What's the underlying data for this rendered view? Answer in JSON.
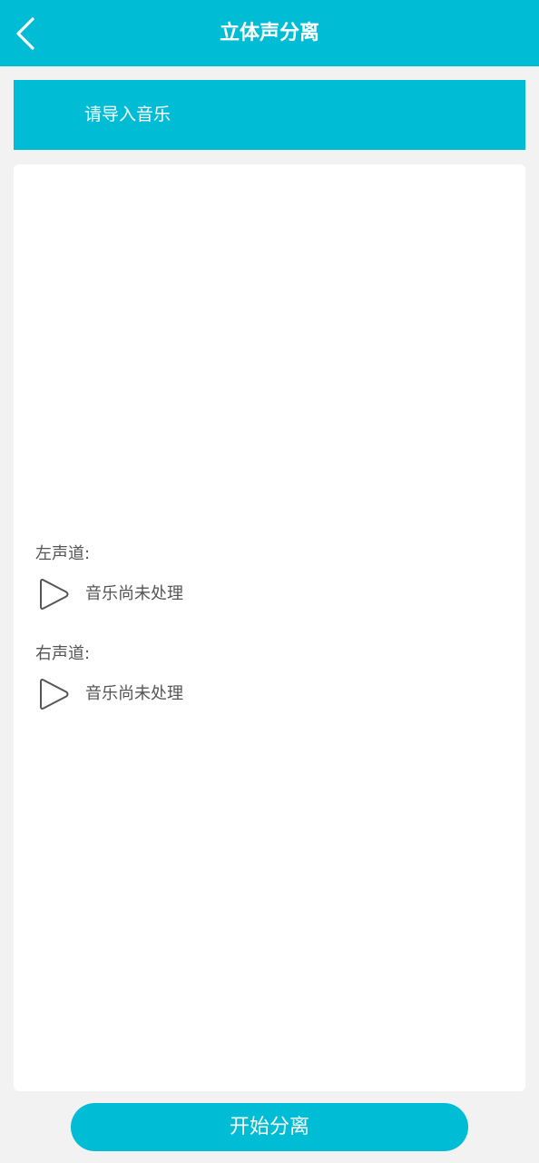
{
  "header": {
    "title": "立体声分离"
  },
  "import": {
    "label": "请导入音乐"
  },
  "channels": [
    {
      "label": "左声道:",
      "status": "音乐尚未处理"
    },
    {
      "label": "右声道:",
      "status": "音乐尚未处理"
    }
  ],
  "actions": {
    "start_label": "开始分离"
  },
  "colors": {
    "accent": "#00bcd4",
    "background": "#f2f2f2",
    "card": "#ffffff",
    "text_secondary": "#555555"
  },
  "icons": {
    "back": "chevron-left-icon",
    "play": "play-icon"
  }
}
